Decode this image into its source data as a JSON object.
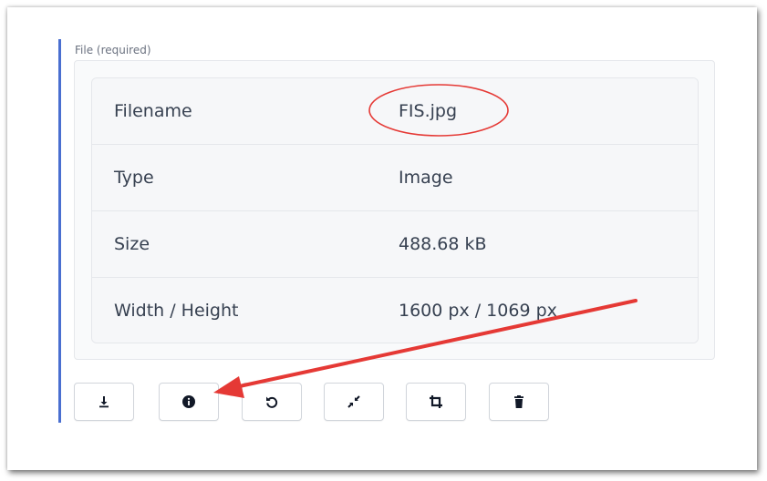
{
  "field": {
    "label": "File (required)"
  },
  "file_info": {
    "rows": [
      {
        "key": "Filename",
        "value": "FIS.jpg"
      },
      {
        "key": "Type",
        "value": "Image"
      },
      {
        "key": "Size",
        "value": "488.68 kB"
      },
      {
        "key": "Width / Height",
        "value": "1600 px / 1069 px"
      }
    ]
  },
  "toolbar": {
    "buttons": [
      {
        "icon": "download-icon"
      },
      {
        "icon": "info-icon"
      },
      {
        "icon": "rotate-icon"
      },
      {
        "icon": "compress-icon"
      },
      {
        "icon": "crop-icon"
      },
      {
        "icon": "trash-icon"
      }
    ]
  },
  "colors": {
    "accent_bar": "#4a6fd0",
    "annotation_red": "#e53935",
    "text": "#374151"
  }
}
